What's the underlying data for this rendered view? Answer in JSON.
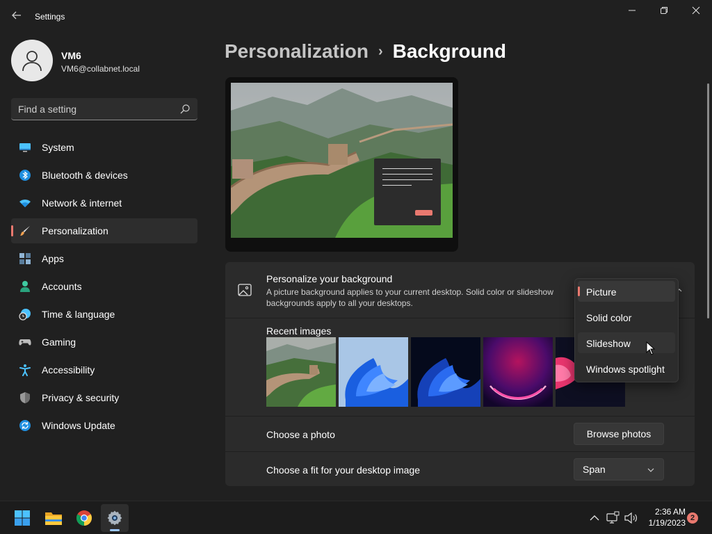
{
  "window": {
    "title": "Settings",
    "back_icon": "back-arrow-icon",
    "controls": {
      "minimize": "—",
      "maximize": "▢",
      "close": "✕"
    }
  },
  "user": {
    "name": "VM6",
    "email": "VM6@collabnet.local",
    "avatar_icon": "person-icon"
  },
  "search": {
    "placeholder": "Find a setting",
    "value": "",
    "icon": "search-icon"
  },
  "sidebar": {
    "items": [
      {
        "label": "System",
        "icon": "monitor-icon",
        "active": false
      },
      {
        "label": "Bluetooth & devices",
        "icon": "bluetooth-icon",
        "active": false
      },
      {
        "label": "Network & internet",
        "icon": "wifi-icon",
        "active": false
      },
      {
        "label": "Personalization",
        "icon": "paintbrush-icon",
        "active": true
      },
      {
        "label": "Apps",
        "icon": "apps-icon",
        "active": false
      },
      {
        "label": "Accounts",
        "icon": "person-icon",
        "active": false
      },
      {
        "label": "Time & language",
        "icon": "clock-globe-icon",
        "active": false
      },
      {
        "label": "Gaming",
        "icon": "gamepad-icon",
        "active": false
      },
      {
        "label": "Accessibility",
        "icon": "accessibility-icon",
        "active": false
      },
      {
        "label": "Privacy & security",
        "icon": "shield-icon",
        "active": false
      },
      {
        "label": "Windows Update",
        "icon": "update-icon",
        "active": false
      }
    ]
  },
  "header": {
    "parent": "Personalization",
    "separator": "›",
    "current": "Background"
  },
  "background_section": {
    "icon": "image-icon",
    "title": "Personalize your background",
    "description": "A picture background applies to your current desktop. Solid color or slideshow backgrounds apply to all your desktops.",
    "dropdown": {
      "selected": "Picture",
      "hovered": "Slideshow",
      "options": [
        "Picture",
        "Solid color",
        "Slideshow",
        "Windows spotlight"
      ]
    }
  },
  "recent_images": {
    "label": "Recent images",
    "items": [
      "great-wall-landscape",
      "blue-bloom-light",
      "blue-bloom-dark",
      "purple-glow",
      "pink-flower"
    ]
  },
  "choose_photo": {
    "label": "Choose a photo",
    "button": "Browse photos"
  },
  "fit": {
    "label": "Choose a fit for your desktop image",
    "value": "Span"
  },
  "taskbar": {
    "apps": [
      "windows-start-icon",
      "file-explorer-icon",
      "chrome-icon",
      "settings-gear-icon"
    ],
    "active_app": "settings-gear-icon",
    "tray_icons": [
      "chevron-up-icon",
      "network-icon",
      "volume-icon"
    ],
    "time": "2:36 AM",
    "date": "1/19/2023",
    "notification_count": "2"
  },
  "colors": {
    "background": "#202020",
    "card": "#2b2b2b",
    "accent": "#e9796f",
    "nav_active": "#2d2d2d",
    "text": "#ffffff",
    "subtext": "#d0d0d0"
  }
}
